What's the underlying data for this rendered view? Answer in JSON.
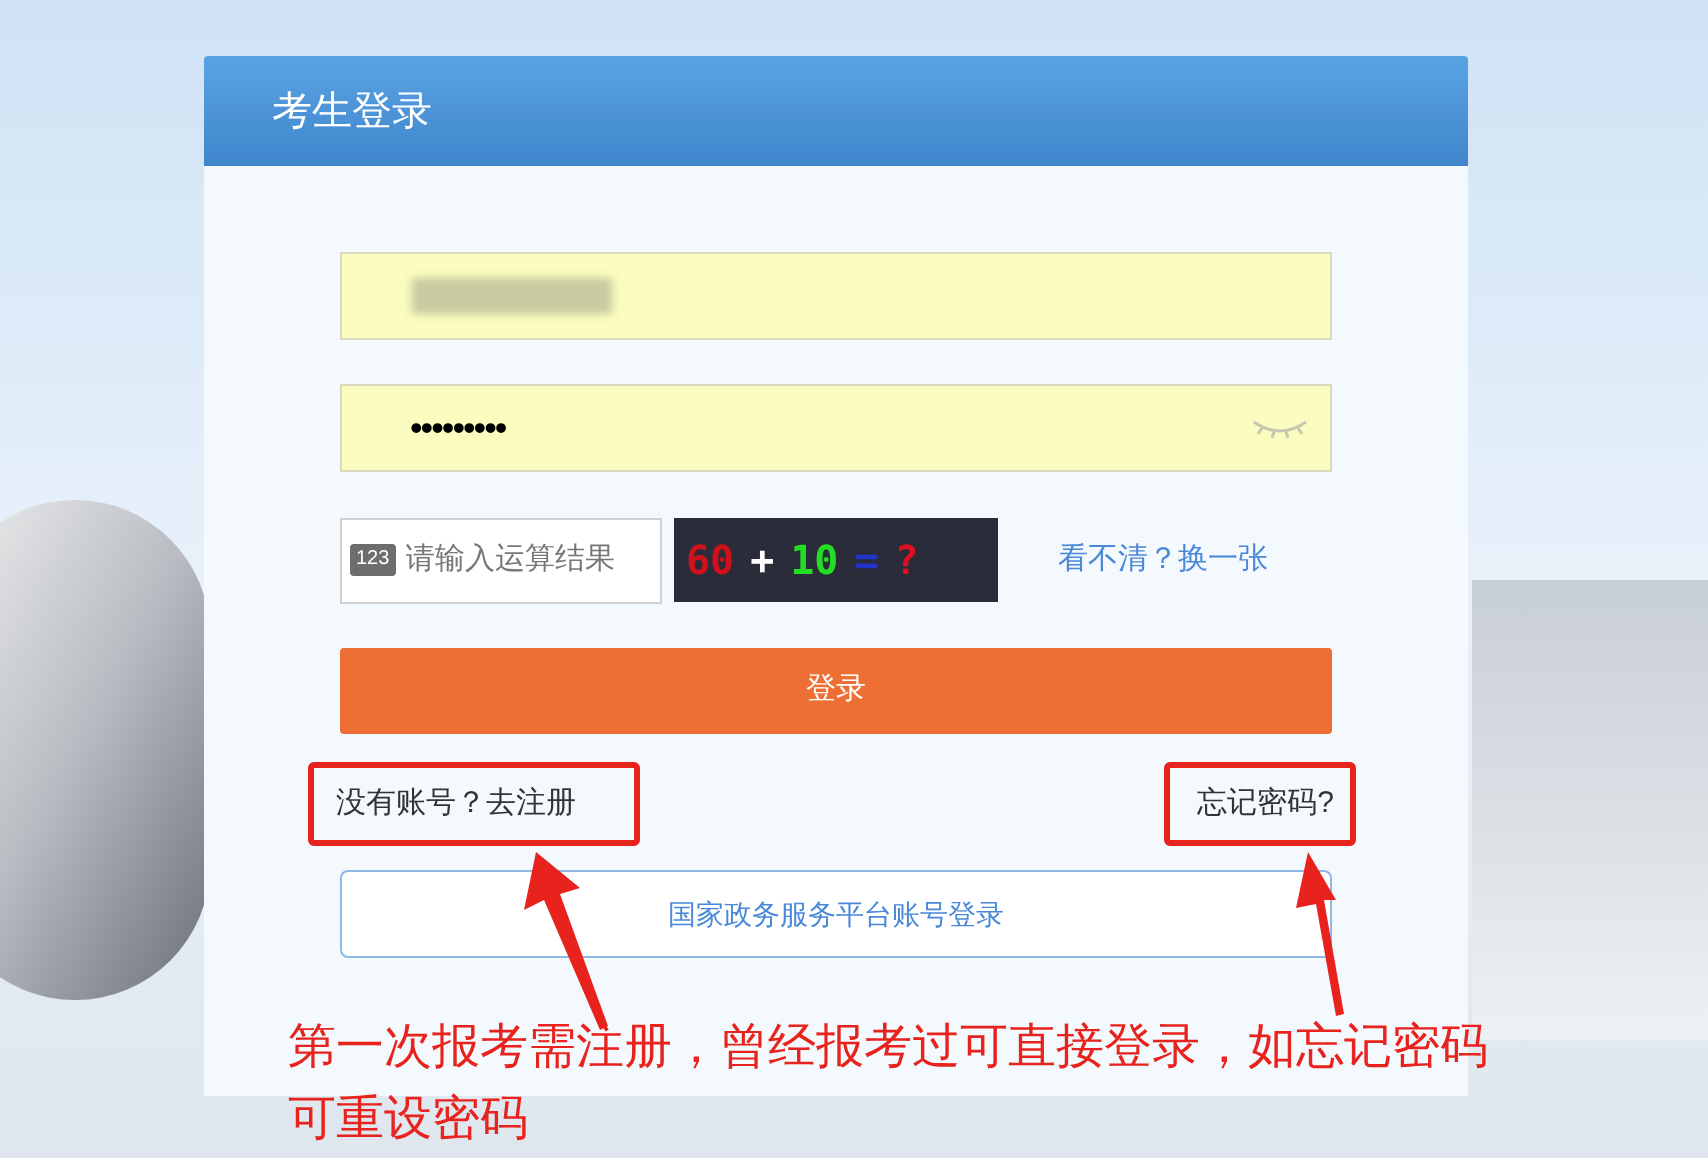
{
  "card": {
    "title": "考生登录"
  },
  "username": {
    "blurred": true
  },
  "password": {
    "value": "•••••••••"
  },
  "captcha": {
    "icon_label": "123",
    "placeholder": "请输入运算结果",
    "tokens": [
      {
        "text": "60",
        "color": "#d0101a"
      },
      {
        "text": "+",
        "color": "#ffffff"
      },
      {
        "text": "10",
        "color": "#22dd22"
      },
      {
        "text": "=",
        "color": "#2233cc"
      },
      {
        "text": "?",
        "color": "#e01020"
      }
    ],
    "refresh_link": "看不清？换一张"
  },
  "login_button": "登录",
  "register_link": "没有账号？去注册",
  "forgot_link": "忘记密码?",
  "gov_login_button": "国家政务服务平台账号登录",
  "annotation": "第一次报考需注册，曾经报考过可直接登录，如忘记密码可重设密码"
}
